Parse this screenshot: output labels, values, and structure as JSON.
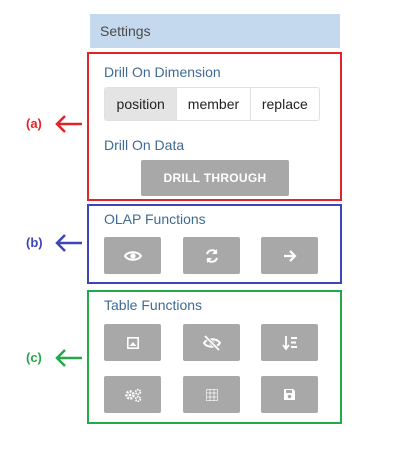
{
  "settings": {
    "title": "Settings"
  },
  "drill_dimension": {
    "title": "Drill On Dimension",
    "options": [
      "position",
      "member",
      "replace"
    ],
    "selected": "position"
  },
  "drill_data": {
    "title": "Drill On Data",
    "button_label": "DRILL THROUGH"
  },
  "olap": {
    "title": "OLAP Functions",
    "buttons": [
      "eye-icon",
      "refresh-icon",
      "arrow-right-icon"
    ]
  },
  "table": {
    "title": "Table Functions",
    "buttons": [
      "image-icon",
      "eye-slash-icon",
      "sort-numeric-down-icon",
      "cogs-icon",
      "grid-icon",
      "save-icon"
    ]
  },
  "annotations": {
    "a": {
      "label": "(a)",
      "color": "#e2232a"
    },
    "b": {
      "label": "(b)",
      "color": "#3d46b6"
    },
    "c": {
      "label": "(c)",
      "color": "#23a84a"
    }
  }
}
